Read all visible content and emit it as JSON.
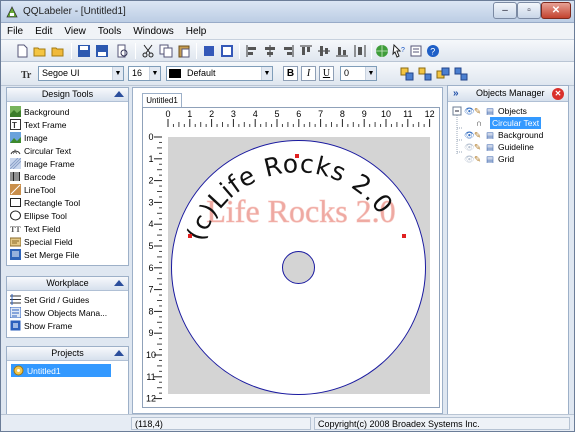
{
  "app": {
    "title": "QQLabeler - [Untitled1]"
  },
  "menu": [
    "File",
    "Edit",
    "View",
    "Tools",
    "Windows",
    "Help"
  ],
  "format_bar": {
    "font_family": "Segoe UI",
    "font_size": "16",
    "color_label": "Default",
    "bold": "B",
    "italic": "I",
    "underline": "U",
    "rotation": "0"
  },
  "design_tools": {
    "title": "Design Tools",
    "items": [
      {
        "label": "Background",
        "icon": "background-icon"
      },
      {
        "label": "Text Frame",
        "icon": "text-frame-icon"
      },
      {
        "label": "Image",
        "icon": "image-icon"
      },
      {
        "label": "Circular Text",
        "icon": "circular-text-icon"
      },
      {
        "label": "Image Frame",
        "icon": "image-frame-icon"
      },
      {
        "label": "Barcode",
        "icon": "barcode-icon"
      },
      {
        "label": "LineTool",
        "icon": "line-tool-icon"
      },
      {
        "label": "Rectangle Tool",
        "icon": "rectangle-tool-icon"
      },
      {
        "label": "Ellipse Tool",
        "icon": "ellipse-tool-icon"
      },
      {
        "label": "Text Field",
        "icon": "text-field-icon"
      },
      {
        "label": "Special Field",
        "icon": "special-field-icon"
      },
      {
        "label": "Set Merge File",
        "icon": "merge-file-icon"
      }
    ]
  },
  "workplace": {
    "title": "Workplace",
    "items": [
      {
        "label": "Set Grid / Guides",
        "icon": "grid-guides-icon"
      },
      {
        "label": "Show Objects Mana...",
        "icon": "objects-manager-icon"
      },
      {
        "label": "Show Frame",
        "icon": "frame-icon"
      }
    ]
  },
  "projects": {
    "title": "Projects",
    "items": [
      {
        "label": "Untitled1",
        "icon": "project-icon"
      }
    ]
  },
  "document": {
    "tab": "Untitled1",
    "ruler_h": [
      "0",
      "1",
      "2",
      "3",
      "4",
      "5",
      "6",
      "7",
      "8",
      "9",
      "10",
      "11",
      "12"
    ],
    "ruler_v": [
      "0",
      "1",
      "2",
      "3",
      "4",
      "5",
      "6",
      "7",
      "8",
      "9",
      "10",
      "11",
      "12"
    ],
    "circular_text": "(c)Life Rocks 2.0",
    "watermark": "Life Rocks 2.0"
  },
  "objects_manager": {
    "title": "Objects Manager",
    "tree": [
      {
        "label": "Objects",
        "level": 0
      },
      {
        "label": "Circular Text",
        "level": 1,
        "selected": true
      },
      {
        "label": "Background",
        "level": 0
      },
      {
        "label": "Guideline",
        "level": 0
      },
      {
        "label": "Grid",
        "level": 0
      }
    ]
  },
  "status": {
    "coords": "(118,4)",
    "copyright": "Copyright(c) 2008 Broadex Systems Inc."
  },
  "colors": {
    "accent": "#3399ff",
    "disc_outline": "#1a1aa0",
    "watermark": "#e0584a",
    "handle": "#e02020"
  }
}
